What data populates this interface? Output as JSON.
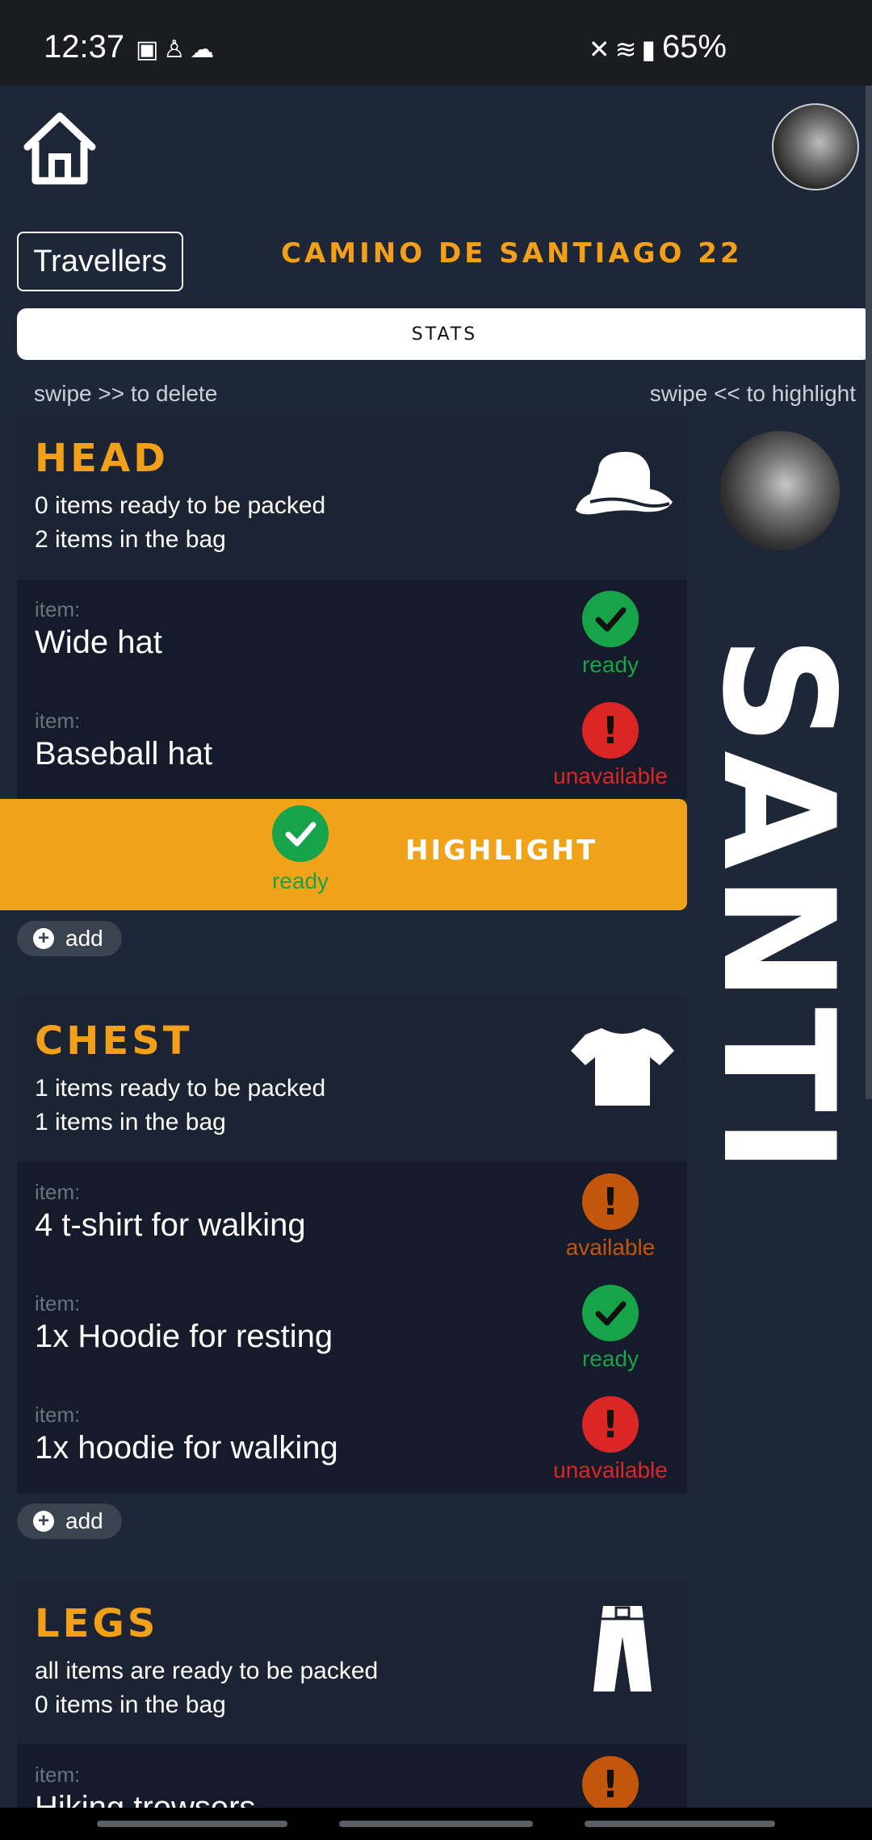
{
  "status_bar": {
    "time": "12:37",
    "left_icons": [
      "gallery-icon",
      "person-icon",
      "cloud-upload-icon"
    ],
    "right_icons": [
      "mute-icon",
      "wifi-icon",
      "signal-icon"
    ],
    "battery": "65%"
  },
  "header": {
    "travellers_label": "Travellers",
    "trip_title": "CAMINO DE SANTIAGO 22",
    "stats_label": "STATS"
  },
  "hints": {
    "left": "swipe >> to delete",
    "right": "swipe << to highlight"
  },
  "traveller": {
    "name": "SANTI"
  },
  "sections": [
    {
      "title": "HEAD",
      "line1": "0 items ready to be packed",
      "line2": "2 items in the bag",
      "icon": "hat-icon",
      "items": [
        {
          "label": "item:",
          "name": "Wide hat",
          "status": "ready"
        },
        {
          "label": "item:",
          "name": "Baseball hat",
          "status": "unavailable"
        }
      ],
      "highlight": {
        "status": "ready",
        "label": "HIGHLIGHT"
      },
      "add_label": "add"
    },
    {
      "title": "CHEST",
      "line1": "1 items ready to be packed",
      "line2": "1 items in the bag",
      "icon": "tshirt-icon",
      "items": [
        {
          "label": "item:",
          "name": "4 t-shirt for walking",
          "status": "available"
        },
        {
          "label": "item:",
          "name": "1x Hoodie for resting",
          "status": "ready"
        },
        {
          "label": "item:",
          "name": "1x hoodie for walking",
          "status": "unavailable"
        }
      ],
      "add_label": "add"
    },
    {
      "title": "LEGS",
      "line1": "all items are ready to be packed",
      "line2": "0 items in the bag",
      "icon": "trousers-icon",
      "items": [
        {
          "label": "item:",
          "name": "Hiking trowsers",
          "status": "available"
        }
      ]
    }
  ],
  "colors": {
    "accent": "#f29f1a",
    "ready": "#16a34a",
    "unavailable": "#dc2626",
    "available": "#c2570c",
    "background": "#1e2738"
  }
}
